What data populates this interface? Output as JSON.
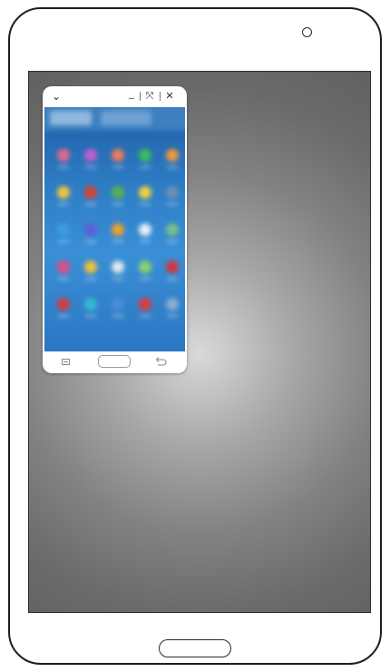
{
  "popup_window": {
    "titlebar": {
      "collapse_glyph": "⌄",
      "minimize_glyph": "_",
      "expand_glyph": "⤧",
      "close_glyph": "✕",
      "icons": [
        "chevron-down-icon",
        "minimize-icon",
        "expand-icon",
        "close-icon"
      ]
    },
    "content": {
      "app_icon_colors": [
        [
          "#e46a8a",
          "#c75bd0",
          "#f07a5a",
          "#3dbf5a",
          "#f09a3a"
        ],
        [
          "#f3c53a",
          "#e0402a",
          "#5ab04e",
          "#f2d33c",
          "#6f8fb0"
        ],
        [
          "#3d9ce0",
          "#5e5fd6",
          "#f0a02c",
          "#e8f0f8",
          "#7ac08a"
        ],
        [
          "#e24d80",
          "#f0c23a",
          "#e0e8f0",
          "#8ed36a",
          "#d8353a"
        ],
        [
          "#d83a3a",
          "#3ab8d0",
          "#4f8ad8",
          "#e03a3a",
          "#8faed0"
        ]
      ]
    },
    "navbar": {
      "icons": [
        "recent-apps-icon",
        "home-button-icon",
        "back-icon"
      ]
    }
  },
  "device": {
    "icons": [
      "front-camera-icon",
      "home-key-icon"
    ]
  },
  "colors": {
    "screen_center": "#d9d9d9",
    "screen_edge": "#616161",
    "popup_content_blue": "#2f7fc7",
    "outline": "#1e1e1e"
  }
}
